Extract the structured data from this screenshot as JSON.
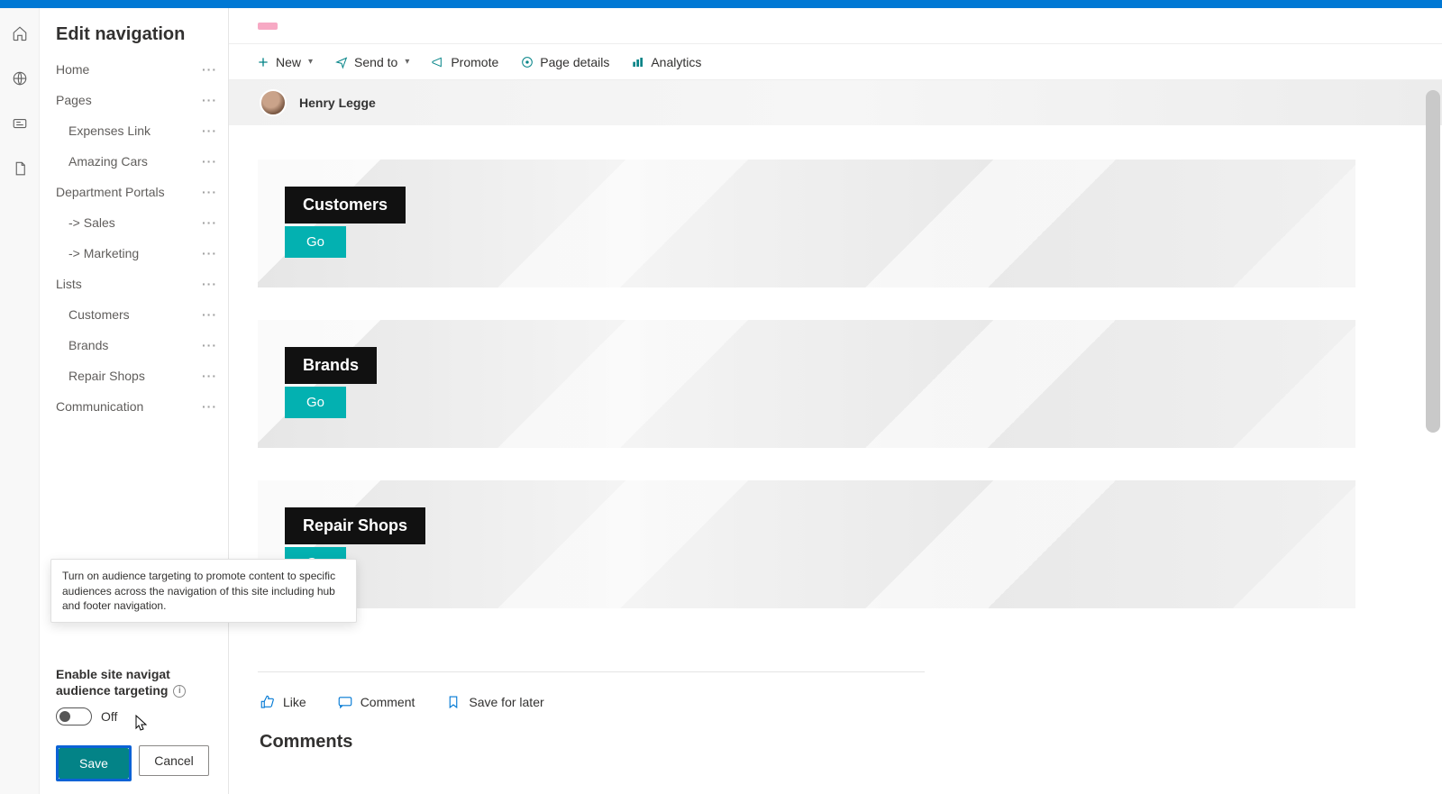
{
  "panel": {
    "title": "Edit navigation",
    "items": [
      {
        "label": "Home",
        "sub": false
      },
      {
        "label": "Pages",
        "sub": false
      },
      {
        "label": "Expenses Link",
        "sub": true
      },
      {
        "label": "Amazing Cars",
        "sub": true
      },
      {
        "label": "Department Portals",
        "sub": false
      },
      {
        "label": "-> Sales",
        "sub": true
      },
      {
        "label": "-> Marketing",
        "sub": true
      },
      {
        "label": "Lists",
        "sub": false
      },
      {
        "label": "Customers",
        "sub": true
      },
      {
        "label": "Brands",
        "sub": true
      },
      {
        "label": "Repair Shops",
        "sub": true
      },
      {
        "label": "Communication",
        "sub": false
      }
    ],
    "toggle_label_1": "Enable site navigat",
    "toggle_label_2": "audience targeting",
    "toggle_state": "Off",
    "save": "Save",
    "cancel": "Cancel"
  },
  "tooltip": "Turn on audience targeting to promote content to specific audiences across the navigation of this site including hub and footer navigation.",
  "cmdbar": {
    "new": "New",
    "sendto": "Send to",
    "promote": "Promote",
    "pagedetails": "Page details",
    "analytics": "Analytics"
  },
  "author": "Henry Legge",
  "cards": [
    {
      "title": "Customers",
      "btn": "Go"
    },
    {
      "title": "Brands",
      "btn": "Go"
    },
    {
      "title": "Repair Shops",
      "btn": "Go"
    }
  ],
  "reactions": {
    "like": "Like",
    "comment": "Comment",
    "save": "Save for later"
  },
  "comments_heading": "Comments"
}
